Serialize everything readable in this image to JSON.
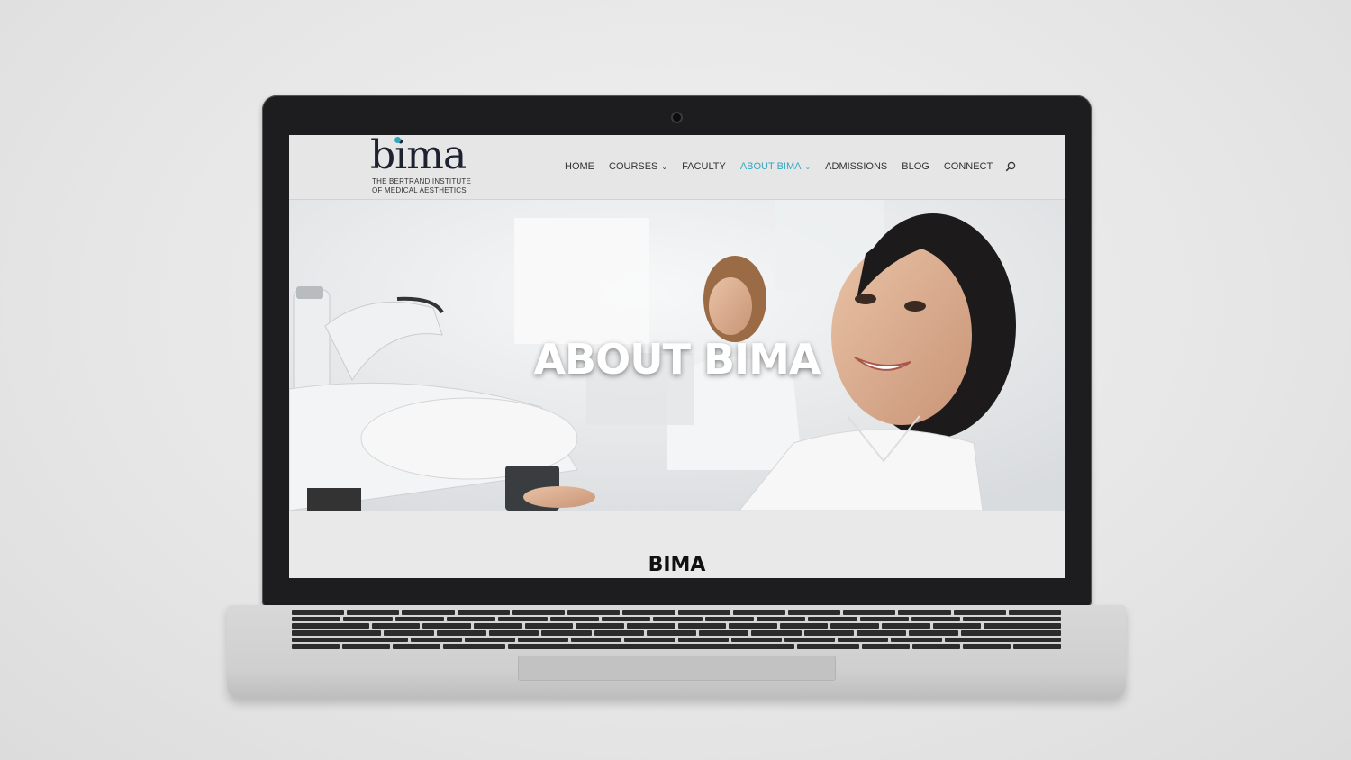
{
  "site": {
    "logo": {
      "word": "bima",
      "tagline_line1": "THE BERTRAND INSTITUTE",
      "tagline_line2": "OF MEDICAL AESTHETICS"
    },
    "nav": [
      {
        "label": "HOME",
        "has_dropdown": false,
        "active": false
      },
      {
        "label": "COURSES",
        "has_dropdown": true,
        "active": false
      },
      {
        "label": "FACULTY",
        "has_dropdown": false,
        "active": false
      },
      {
        "label": "ABOUT BIMA",
        "has_dropdown": true,
        "active": true
      },
      {
        "label": "ADMISSIONS",
        "has_dropdown": false,
        "active": false
      },
      {
        "label": "BLOG",
        "has_dropdown": false,
        "active": false
      },
      {
        "label": "CONNECT",
        "has_dropdown": false,
        "active": false
      }
    ],
    "search_icon": "search-icon",
    "hero": {
      "title": "ABOUT BIMA"
    },
    "content": {
      "title": "BIMA"
    }
  },
  "colors": {
    "accent": "#35a6c0",
    "logo_text": "#1e2230",
    "header_bg": "#e6e6e6"
  }
}
